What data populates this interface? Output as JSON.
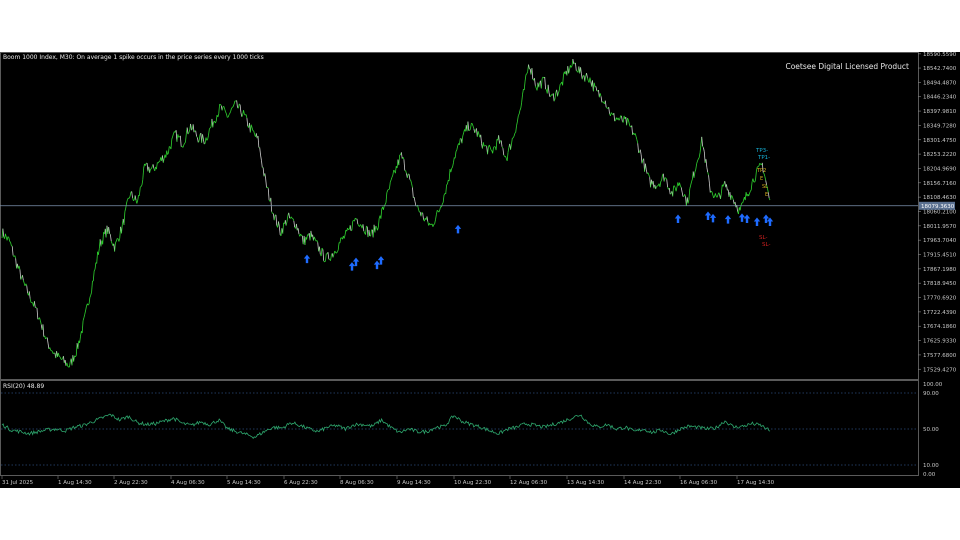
{
  "window": {
    "header_text": "Boom 1000 Index, M30:  On average 1 spike occurs in the price series every 1000 ticks",
    "watermark": "Coetsee Digital Licensed Product",
    "current_price_label": "18079.3630",
    "colors": {
      "background": "#000000",
      "price_up": "#2fd12f",
      "price_flat": "#cccccc",
      "rsi_line": "#2ea86e",
      "buy_arrow": "#1e6bff",
      "tp_label": "#16b2d8",
      "sl_label": "#d02020",
      "level_label": "#d8b020",
      "grid_dots": "#2c4a7a"
    }
  },
  "price_axis": {
    "ticks": [
      "18590.5590",
      "18542.7400",
      "18494.4870",
      "18446.2340",
      "18397.9810",
      "18349.7280",
      "18301.4750",
      "18253.2220",
      "18204.9690",
      "18156.7160",
      "18108.4630",
      "18060.2100",
      "18011.9570",
      "17963.7040",
      "17915.4510",
      "17867.1980",
      "17818.9450",
      "17770.6920",
      "17722.4390",
      "17674.1860",
      "17625.9330",
      "17577.6800",
      "17529.4270"
    ]
  },
  "rsi_panel": {
    "label": "RSI(20) 48.89",
    "ticks": [
      "100.00",
      "90.00",
      "50.00",
      "10.00",
      "0.00"
    ]
  },
  "time_axis": {
    "ticks": [
      "31 Jul 2025",
      "1 Aug 14:30",
      "2 Aug 22:30",
      "4 Aug 06:30",
      "5 Aug 14:30",
      "6 Aug 22:30",
      "8 Aug 06:30",
      "9 Aug 14:30",
      "10 Aug 22:30",
      "12 Aug 06:30",
      "13 Aug 14:30",
      "14 Aug 22:30",
      "16 Aug 06:30",
      "17 Aug 14:30"
    ]
  },
  "trade_labels": {
    "tp": [
      "TP3-",
      "TP1-"
    ],
    "levels": [
      "TP2",
      "E",
      "SL",
      "E"
    ],
    "sl": [
      "SL-",
      "SL-"
    ]
  },
  "chart_data": [
    {
      "type": "line",
      "title": "Boom 1000 Index, M30",
      "series": [
        {
          "values": [
            17990,
            17960,
            17880,
            17810,
            17760,
            17700,
            17620,
            17580,
            17560,
            17540,
            17600,
            17700,
            17820,
            17950,
            18000,
            17940,
            18010,
            18120,
            18090,
            18210,
            18200,
            18230,
            18260,
            18320,
            18290,
            18350,
            18310,
            18300,
            18360,
            18410,
            18380,
            18420,
            18390,
            18340,
            18300,
            18160,
            18060,
            17990,
            18040,
            18020,
            17960,
            17980,
            17940,
            17900,
            17920,
            17960,
            17990,
            18040,
            18010,
            17980,
            18020,
            18100,
            18180,
            18250,
            18180,
            18080,
            18040,
            18010,
            18060,
            18140,
            18240,
            18300,
            18350,
            18330,
            18280,
            18260,
            18300,
            18240,
            18320,
            18420,
            18560,
            18480,
            18500,
            18440,
            18470,
            18530,
            18560,
            18520,
            18510,
            18460,
            18440,
            18380,
            18370,
            18360,
            18320,
            18240,
            18160,
            18150,
            18180,
            18120,
            18160,
            18090,
            18200,
            18300,
            18140,
            18100,
            18150,
            18110,
            18060,
            18120,
            18180,
            18220,
            18090
          ]
        }
      ],
      "ylim": [
        17500,
        18590
      ],
      "buy_arrow_prices": [
        17915,
        17890,
        17905,
        17895,
        17910,
        18015,
        18050,
        18060,
        18052,
        18048,
        18054,
        18050,
        18040,
        18050,
        18040
      ]
    },
    {
      "type": "line",
      "title": "RSI(20) 48.89",
      "series": [
        {
          "values": [
            55,
            49,
            47,
            45,
            47,
            49,
            50,
            48,
            52,
            54,
            58,
            62,
            66,
            60,
            64,
            57,
            55,
            56,
            59,
            62,
            56,
            54,
            58,
            55,
            60,
            50,
            47,
            44,
            41,
            47,
            52,
            51,
            57,
            54,
            50,
            47,
            52,
            54,
            50,
            55,
            55,
            53,
            60,
            52,
            46,
            50,
            47,
            47,
            52,
            53,
            65,
            58,
            55,
            52,
            48,
            45,
            50,
            52,
            56,
            54,
            52,
            55,
            58,
            62,
            66,
            56,
            52,
            55,
            50,
            52,
            47,
            50,
            46,
            49,
            44,
            50,
            53,
            52,
            50,
            51,
            59,
            52,
            53,
            56,
            54,
            48
          ],
          "last_value": 48.89
        }
      ],
      "ylim": [
        0,
        100
      ],
      "levels": [
        90,
        50,
        10
      ]
    }
  ]
}
